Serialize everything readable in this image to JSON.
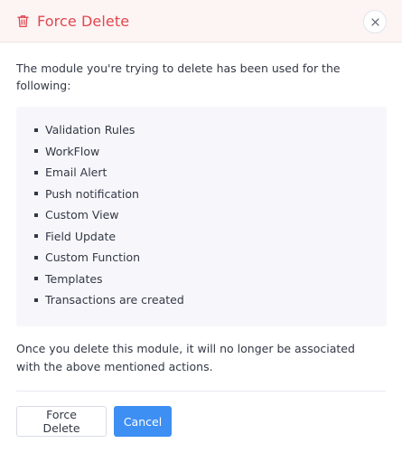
{
  "dialog": {
    "title": "Force Delete",
    "intro": "The module you're trying to delete has been used for the following:",
    "items": [
      "Validation Rules",
      "WorkFlow",
      "Email Alert",
      "Push notification",
      "Custom View",
      "Field Update",
      "Custom Function",
      "Templates",
      "Transactions are created"
    ],
    "outro": "Once you delete this module, it will no longer be associated with the above mentioned actions.",
    "force_delete_label": "Force Delete",
    "cancel_label": "Cancel"
  },
  "colors": {
    "title": "#e0484e",
    "header_bg": "#fdf4f4",
    "list_bg": "#f7f7fb",
    "primary": "#3e8ff3"
  },
  "icons": {
    "title_icon": "trash-icon",
    "close_icon": "close-icon"
  }
}
